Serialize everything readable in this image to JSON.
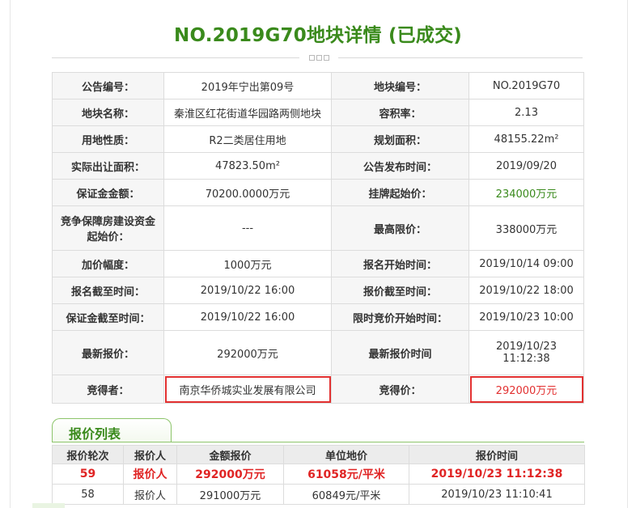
{
  "page_title": "NO.2019G70地块详情 (已成交)",
  "details": [
    {
      "l1": "公告编号：",
      "v1": "2019年宁出第09号",
      "l2": "地块编号：",
      "v2": "NO.2019G70"
    },
    {
      "l1": "地块名称：",
      "v1": "秦淮区红花街道华园路两侧地块",
      "l2": "容积率：",
      "v2": "2.13"
    },
    {
      "l1": "用地性质：",
      "v1": "R2二类居住用地",
      "l2": "规划面积：",
      "v2": "48155.22m²"
    },
    {
      "l1": "实际出让面积：",
      "v1": "47823.50m²",
      "l2": "公告发布时间：",
      "v2": "2019/09/20"
    },
    {
      "l1": "保证金金额：",
      "v1": "70200.0000万元",
      "l2": "挂牌起始价：",
      "v2": "234000万元"
    },
    {
      "l1": "竞争保障房建设资金起始价：",
      "v1": "---",
      "l2": "最高限价：",
      "v2": "338000万元"
    },
    {
      "l1": "加价幅度：",
      "v1": "1000万元",
      "l2": "报名开始时间：",
      "v2": "2019/10/14 09:00"
    },
    {
      "l1": "报名截至时间：",
      "v1": "2019/10/22 16:00",
      "l2": "报价截至时间：",
      "v2": "2019/10/22 18:00"
    },
    {
      "l1": "保证金截至时间：",
      "v1": "2019/10/22 16:00",
      "l2": "限时竞价开始时间：",
      "v2": "2019/10/23 10:00"
    },
    {
      "l1": "最新报价：",
      "v1": "292000万元",
      "l2": "最新报价时间",
      "v2": "2019/10/23 11:12:38"
    },
    {
      "l1": "竞得者：",
      "v1": "南京华侨城实业发展有限公司",
      "l2": "竞得价：",
      "v2": "292000万元"
    }
  ],
  "bid_list": {
    "title": "报价列表",
    "headers": [
      "报价轮次",
      "报价人",
      "金额报价",
      "单位地价",
      "报价时间"
    ],
    "rows": [
      [
        "59",
        "报价人",
        "292000万元",
        "61058元/平米",
        "2019/10/23 11:12:38"
      ],
      [
        "58",
        "报价人",
        "291000万元",
        "60849元/平米",
        "2019/10/23 11:10:41"
      ]
    ]
  },
  "colors": {
    "accent_green": "#3a8a1c",
    "highlight_red": "#e23030"
  }
}
